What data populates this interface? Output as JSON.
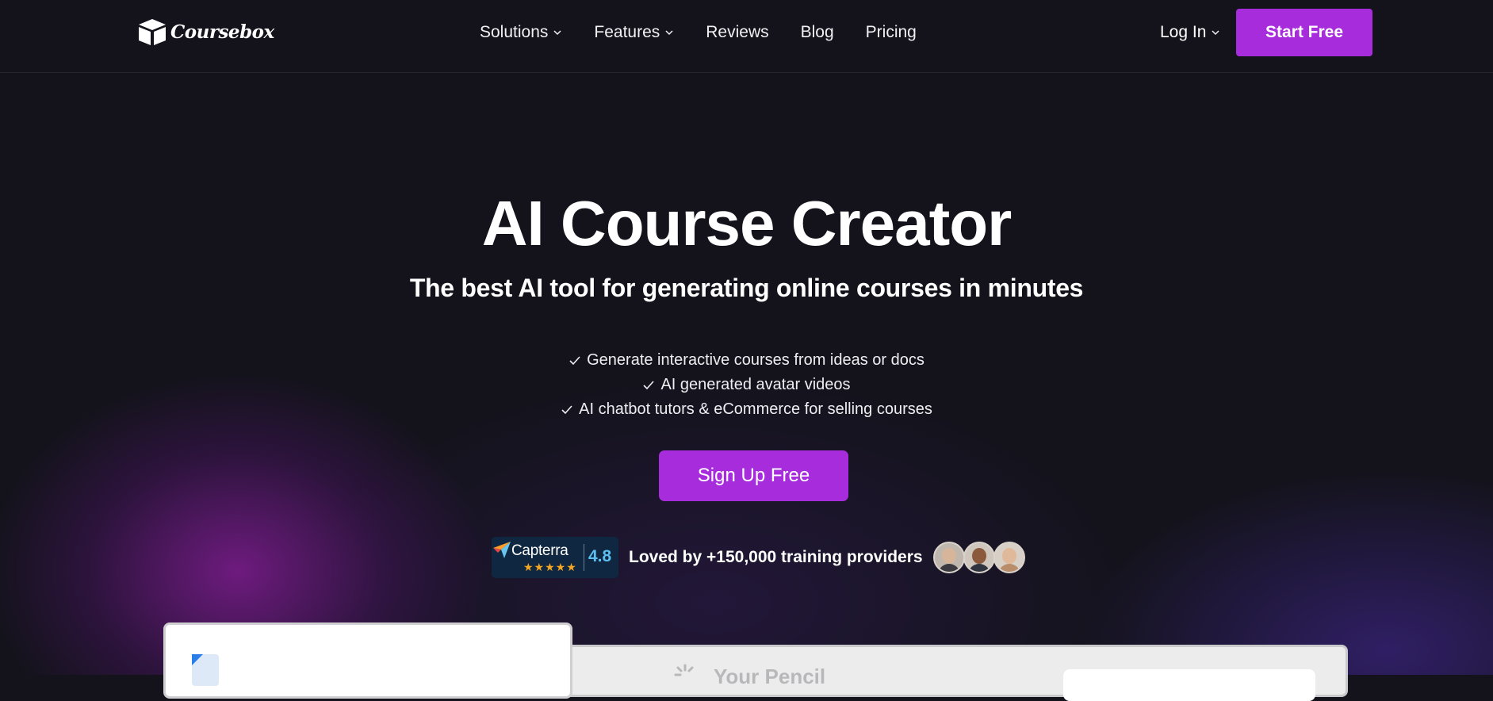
{
  "header": {
    "logo_text": "Coursebox",
    "nav": [
      {
        "label": "Solutions",
        "has_dropdown": true
      },
      {
        "label": "Features",
        "has_dropdown": true
      },
      {
        "label": "Reviews",
        "has_dropdown": false
      },
      {
        "label": "Blog",
        "has_dropdown": false
      },
      {
        "label": "Pricing",
        "has_dropdown": false
      }
    ],
    "login_label": "Log In",
    "cta_label": "Start Free"
  },
  "hero": {
    "title": "AI Course Creator",
    "subtitle": "The best AI tool for generating online courses in minutes",
    "features": [
      "Generate interactive courses from ideas or docs",
      "AI generated avatar videos",
      "AI chatbot tutors & eCommerce for selling courses"
    ],
    "cta_label": "Sign Up Free"
  },
  "social_proof": {
    "badge_name": "Capterra",
    "rating": "4.8",
    "stars": "★★★★★",
    "tagline": "Loved by +150,000 training providers"
  },
  "preview": {
    "faded_title": "Your Pencil"
  },
  "colors": {
    "background": "#14131c",
    "accent": "#a72cdc",
    "capterra_bg": "#0f2740",
    "capterra_score": "#5cc0f0",
    "star": "#f5a623"
  }
}
